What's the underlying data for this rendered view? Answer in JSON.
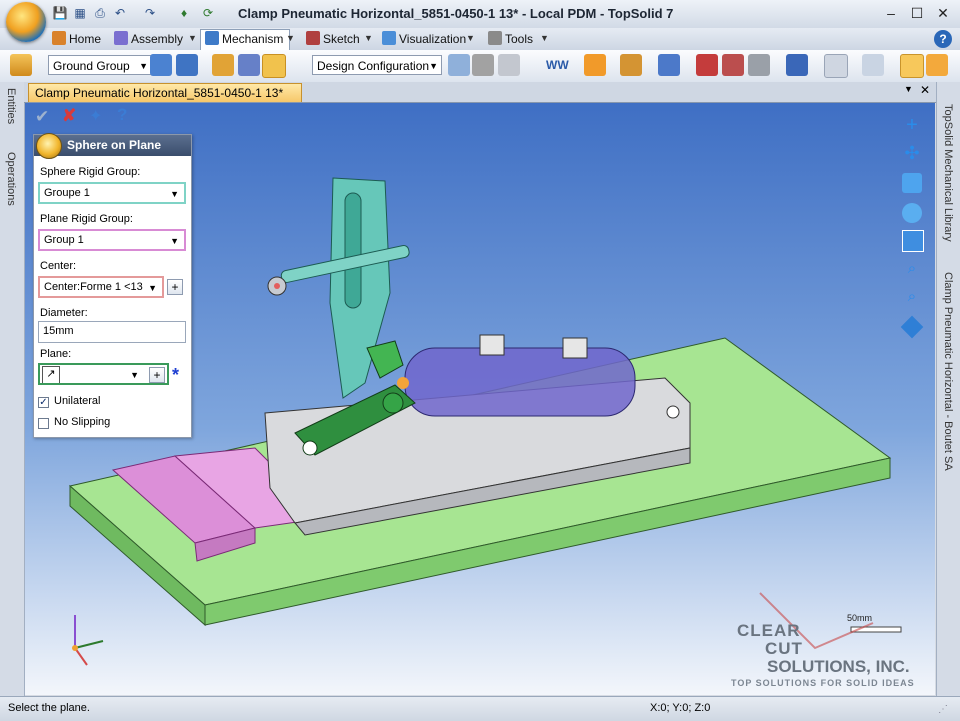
{
  "window": {
    "title": "Clamp Pneumatic Horizontal_5851-0450-1 13* - Local PDM - TopSolid 7"
  },
  "ribbon": {
    "tabs": [
      {
        "label": "Home",
        "icon": "home-icon"
      },
      {
        "label": "Assembly",
        "icon": "assembly-icon"
      },
      {
        "label": "Mechanism",
        "icon": "mechanism-icon"
      },
      {
        "label": "Sketch",
        "icon": "sketch-icon"
      },
      {
        "label": "Visualization",
        "icon": "visualization-icon"
      },
      {
        "label": "Tools",
        "icon": "tools-icon"
      }
    ],
    "active_tab": "Mechanism"
  },
  "toolbar": {
    "ground_group": "Ground Group",
    "design_configuration": "Design Configuration"
  },
  "document": {
    "tab_title": "Clamp Pneumatic Horizontal_5851-0450-1 13*"
  },
  "left_strip": [
    "Entities",
    "Operations"
  ],
  "right_strip": [
    "TopSolid Mechanical Library",
    "Clamp Pneumatic Horizontal - Boutet SA"
  ],
  "panel": {
    "title": "Sphere on Plane",
    "sphere_group_label": "Sphere Rigid Group:",
    "sphere_group_value": "Groupe 1",
    "plane_group_label": "Plane Rigid Group:",
    "plane_group_value": "Group 1",
    "center_label": "Center:",
    "center_value": "Center:Forme 1 <13",
    "diameter_label": "Diameter:",
    "diameter_value": "15mm",
    "plane_label": "Plane:",
    "plane_value": "",
    "unilateral_label": "Unilateral",
    "unilateral_checked": true,
    "no_slipping_label": "No Slipping",
    "no_slipping_checked": false
  },
  "viewport": {
    "scale_label": "50mm",
    "watermark_line1": "CLEAR",
    "watermark_line2": "CUT",
    "watermark_line3": "SOLUTIONS, INC.",
    "watermark_tagline": "TOP SOLUTIONS FOR SOLID IDEAS"
  },
  "status": {
    "message": "Select the plane.",
    "coords": "X:0; Y:0; Z:0"
  },
  "colors": {
    "base_plate": "#9fe08a",
    "pink_part": "#d98ad6",
    "teal_arm": "#5fc2b4",
    "blue_cylinder": "#6f68c8",
    "green_handle": "#2f8f3f",
    "accent_orange": "#f3b23a"
  }
}
